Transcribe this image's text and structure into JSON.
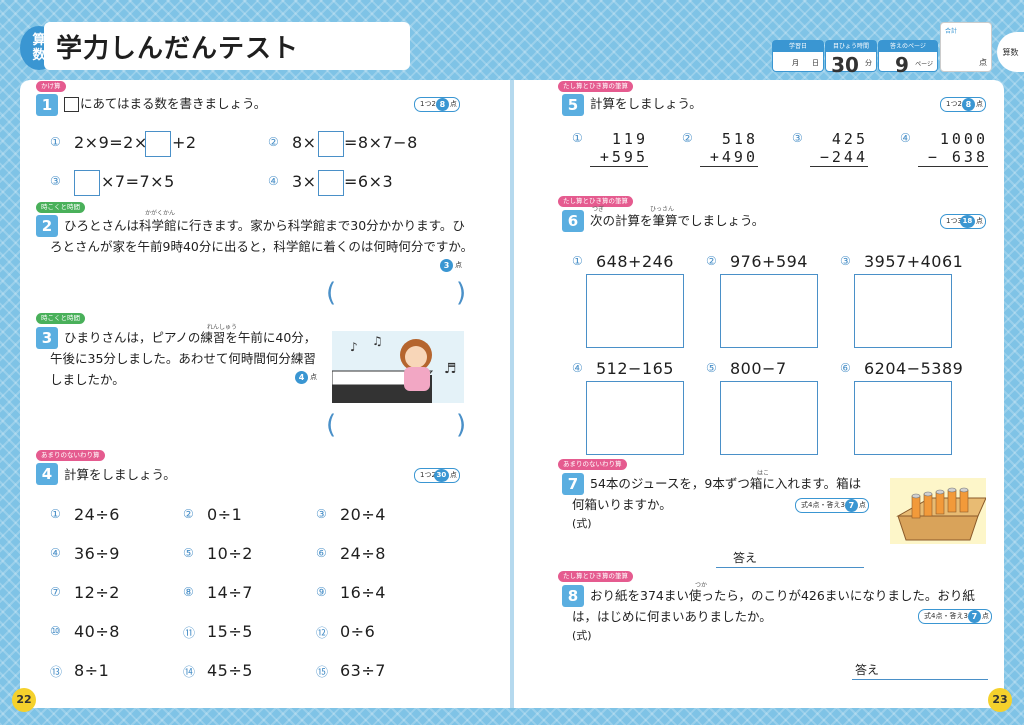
{
  "header": {
    "subject": "算数",
    "title": "学力しんだんテスト",
    "info": {
      "date_label": "学習日",
      "month": "月",
      "day": "日",
      "time_label": "目ひょう時間",
      "time_value": "30",
      "time_unit": "分",
      "answer_label": "答えのページ",
      "answer_value": "9",
      "answer_unit": "ページ",
      "total_label": "合計",
      "total_unit": "点"
    },
    "side_tab": "算数"
  },
  "left": {
    "page_number": "22",
    "q1": {
      "tag": "かけ算",
      "num": "1",
      "text": "にあてはまる数を書きましょう。",
      "pts_label": "1つ2点",
      "pts": "8",
      "pts_unit": "点",
      "items": [
        {
          "n": "①",
          "pre": "2×9=2×",
          "post": "+2"
        },
        {
          "n": "②",
          "pre": "8×",
          "post": "=8×7−8"
        },
        {
          "n": "③",
          "pre": "",
          "post": "×7=7×5"
        },
        {
          "n": "④",
          "pre": "3×",
          "post": "=6×3"
        }
      ]
    },
    "q2": {
      "tag": "時こくと時間",
      "num": "2",
      "ruby": "かがくかん",
      "line1": "ひろとさんは科学館に行きます。家から科学館まで30分かかります。ひ",
      "line2": "ろとさんが家を午前9時40分に出ると，科学館に着くのは何時何分ですか。",
      "pts": "3",
      "pts_unit": "点",
      "paren_l": "(",
      "paren_r": ")"
    },
    "q3": {
      "tag": "時こくと時間",
      "num": "3",
      "ruby": "れんしゅう",
      "line1": "ひまりさんは，ピアノの練習を午前に40分，",
      "line2": "午後に35分しました。あわせて何時間何分練習",
      "line3": "しましたか。",
      "pts": "4",
      "pts_unit": "点",
      "paren_l": "(",
      "paren_r": ")"
    },
    "q4": {
      "tag": "あまりのないわり算",
      "num": "4",
      "text": "計算をしましょう。",
      "pts_label": "1つ2点",
      "pts": "30",
      "pts_unit": "点",
      "items": [
        {
          "n": "①",
          "e": "24÷6"
        },
        {
          "n": "②",
          "e": "0÷1"
        },
        {
          "n": "③",
          "e": "20÷4"
        },
        {
          "n": "④",
          "e": "36÷9"
        },
        {
          "n": "⑤",
          "e": "10÷2"
        },
        {
          "n": "⑥",
          "e": "24÷8"
        },
        {
          "n": "⑦",
          "e": "12÷2"
        },
        {
          "n": "⑧",
          "e": "14÷7"
        },
        {
          "n": "⑨",
          "e": "16÷4"
        },
        {
          "n": "⑩",
          "e": "40÷8"
        },
        {
          "n": "⑪",
          "e": "15÷5"
        },
        {
          "n": "⑫",
          "e": "0÷6"
        },
        {
          "n": "⑬",
          "e": "8÷1"
        },
        {
          "n": "⑭",
          "e": "45÷5"
        },
        {
          "n": "⑮",
          "e": "63÷7"
        }
      ]
    }
  },
  "right": {
    "page_number": "23",
    "q5": {
      "tag": "たし算とひき算の筆算",
      "num": "5",
      "text": "計算をしましょう。",
      "pts_label": "1つ2点",
      "pts": "8",
      "pts_unit": "点",
      "items": [
        {
          "n": "①",
          "top": "119",
          "bot": "+595"
        },
        {
          "n": "②",
          "top": "518",
          "bot": "+490"
        },
        {
          "n": "③",
          "top": "425",
          "bot": "−244"
        },
        {
          "n": "④",
          "top": "1000",
          "bot": "− 638"
        }
      ]
    },
    "q6": {
      "tag": "たし算とひき算の筆算",
      "num": "6",
      "ruby1": "つぎ",
      "ruby2": "ひっさん",
      "text": "次の計算を筆算でしましょう。",
      "pts_label": "1つ3点",
      "pts": "18",
      "pts_unit": "点",
      "items": [
        {
          "n": "①",
          "e": "648+246"
        },
        {
          "n": "②",
          "e": "976+594"
        },
        {
          "n": "③",
          "e": "3957+4061"
        },
        {
          "n": "④",
          "e": "512−165"
        },
        {
          "n": "⑤",
          "e": "800−7"
        },
        {
          "n": "⑥",
          "e": "6204−5389"
        }
      ]
    },
    "q7": {
      "tag": "あまりのないわり算",
      "num": "7",
      "ruby": "はこ",
      "line1": "54本のジュースを，9本ずつ箱に入れます。箱は",
      "line2": "何箱いりますか。",
      "shiki": "(式)",
      "pts_label": "式4点・答え3点",
      "pts": "7",
      "pts_unit": "点",
      "answer": "答え"
    },
    "q8": {
      "tag": "たし算とひき算の筆算",
      "num": "8",
      "ruby": "つか",
      "line1": "おり紙を374まい使ったら，のこりが426まいになりました。おり紙",
      "line2": "は，はじめに何まいありましたか。",
      "shiki": "(式)",
      "pts_label": "式4点・答え3点",
      "pts": "7",
      "pts_unit": "点",
      "answer": "答え"
    }
  }
}
